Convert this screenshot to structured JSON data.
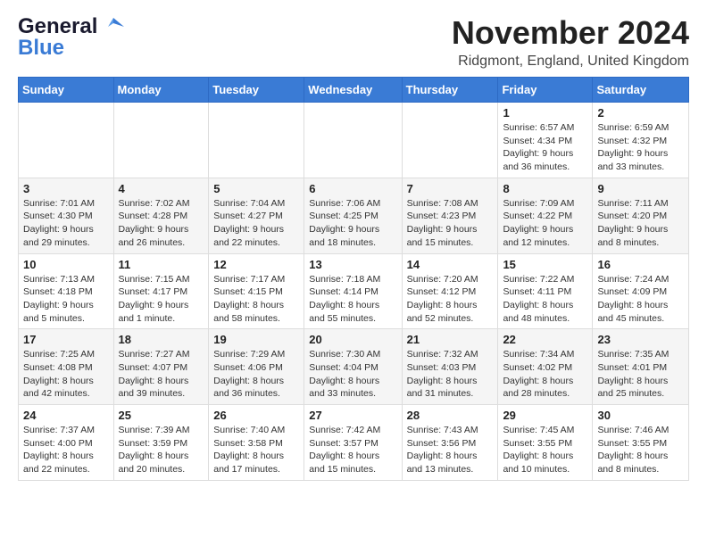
{
  "logo": {
    "line1": "General",
    "line2": "Blue"
  },
  "title": "November 2024",
  "subtitle": "Ridgmont, England, United Kingdom",
  "weekdays": [
    "Sunday",
    "Monday",
    "Tuesday",
    "Wednesday",
    "Thursday",
    "Friday",
    "Saturday"
  ],
  "weeks": [
    [
      {
        "day": "",
        "info": ""
      },
      {
        "day": "",
        "info": ""
      },
      {
        "day": "",
        "info": ""
      },
      {
        "day": "",
        "info": ""
      },
      {
        "day": "",
        "info": ""
      },
      {
        "day": "1",
        "info": "Sunrise: 6:57 AM\nSunset: 4:34 PM\nDaylight: 9 hours\nand 36 minutes."
      },
      {
        "day": "2",
        "info": "Sunrise: 6:59 AM\nSunset: 4:32 PM\nDaylight: 9 hours\nand 33 minutes."
      }
    ],
    [
      {
        "day": "3",
        "info": "Sunrise: 7:01 AM\nSunset: 4:30 PM\nDaylight: 9 hours\nand 29 minutes."
      },
      {
        "day": "4",
        "info": "Sunrise: 7:02 AM\nSunset: 4:28 PM\nDaylight: 9 hours\nand 26 minutes."
      },
      {
        "day": "5",
        "info": "Sunrise: 7:04 AM\nSunset: 4:27 PM\nDaylight: 9 hours\nand 22 minutes."
      },
      {
        "day": "6",
        "info": "Sunrise: 7:06 AM\nSunset: 4:25 PM\nDaylight: 9 hours\nand 18 minutes."
      },
      {
        "day": "7",
        "info": "Sunrise: 7:08 AM\nSunset: 4:23 PM\nDaylight: 9 hours\nand 15 minutes."
      },
      {
        "day": "8",
        "info": "Sunrise: 7:09 AM\nSunset: 4:22 PM\nDaylight: 9 hours\nand 12 minutes."
      },
      {
        "day": "9",
        "info": "Sunrise: 7:11 AM\nSunset: 4:20 PM\nDaylight: 9 hours\nand 8 minutes."
      }
    ],
    [
      {
        "day": "10",
        "info": "Sunrise: 7:13 AM\nSunset: 4:18 PM\nDaylight: 9 hours\nand 5 minutes."
      },
      {
        "day": "11",
        "info": "Sunrise: 7:15 AM\nSunset: 4:17 PM\nDaylight: 9 hours\nand 1 minute."
      },
      {
        "day": "12",
        "info": "Sunrise: 7:17 AM\nSunset: 4:15 PM\nDaylight: 8 hours\nand 58 minutes."
      },
      {
        "day": "13",
        "info": "Sunrise: 7:18 AM\nSunset: 4:14 PM\nDaylight: 8 hours\nand 55 minutes."
      },
      {
        "day": "14",
        "info": "Sunrise: 7:20 AM\nSunset: 4:12 PM\nDaylight: 8 hours\nand 52 minutes."
      },
      {
        "day": "15",
        "info": "Sunrise: 7:22 AM\nSunset: 4:11 PM\nDaylight: 8 hours\nand 48 minutes."
      },
      {
        "day": "16",
        "info": "Sunrise: 7:24 AM\nSunset: 4:09 PM\nDaylight: 8 hours\nand 45 minutes."
      }
    ],
    [
      {
        "day": "17",
        "info": "Sunrise: 7:25 AM\nSunset: 4:08 PM\nDaylight: 8 hours\nand 42 minutes."
      },
      {
        "day": "18",
        "info": "Sunrise: 7:27 AM\nSunset: 4:07 PM\nDaylight: 8 hours\nand 39 minutes."
      },
      {
        "day": "19",
        "info": "Sunrise: 7:29 AM\nSunset: 4:06 PM\nDaylight: 8 hours\nand 36 minutes."
      },
      {
        "day": "20",
        "info": "Sunrise: 7:30 AM\nSunset: 4:04 PM\nDaylight: 8 hours\nand 33 minutes."
      },
      {
        "day": "21",
        "info": "Sunrise: 7:32 AM\nSunset: 4:03 PM\nDaylight: 8 hours\nand 31 minutes."
      },
      {
        "day": "22",
        "info": "Sunrise: 7:34 AM\nSunset: 4:02 PM\nDaylight: 8 hours\nand 28 minutes."
      },
      {
        "day": "23",
        "info": "Sunrise: 7:35 AM\nSunset: 4:01 PM\nDaylight: 8 hours\nand 25 minutes."
      }
    ],
    [
      {
        "day": "24",
        "info": "Sunrise: 7:37 AM\nSunset: 4:00 PM\nDaylight: 8 hours\nand 22 minutes."
      },
      {
        "day": "25",
        "info": "Sunrise: 7:39 AM\nSunset: 3:59 PM\nDaylight: 8 hours\nand 20 minutes."
      },
      {
        "day": "26",
        "info": "Sunrise: 7:40 AM\nSunset: 3:58 PM\nDaylight: 8 hours\nand 17 minutes."
      },
      {
        "day": "27",
        "info": "Sunrise: 7:42 AM\nSunset: 3:57 PM\nDaylight: 8 hours\nand 15 minutes."
      },
      {
        "day": "28",
        "info": "Sunrise: 7:43 AM\nSunset: 3:56 PM\nDaylight: 8 hours\nand 13 minutes."
      },
      {
        "day": "29",
        "info": "Sunrise: 7:45 AM\nSunset: 3:55 PM\nDaylight: 8 hours\nand 10 minutes."
      },
      {
        "day": "30",
        "info": "Sunrise: 7:46 AM\nSunset: 3:55 PM\nDaylight: 8 hours\nand 8 minutes."
      }
    ]
  ]
}
